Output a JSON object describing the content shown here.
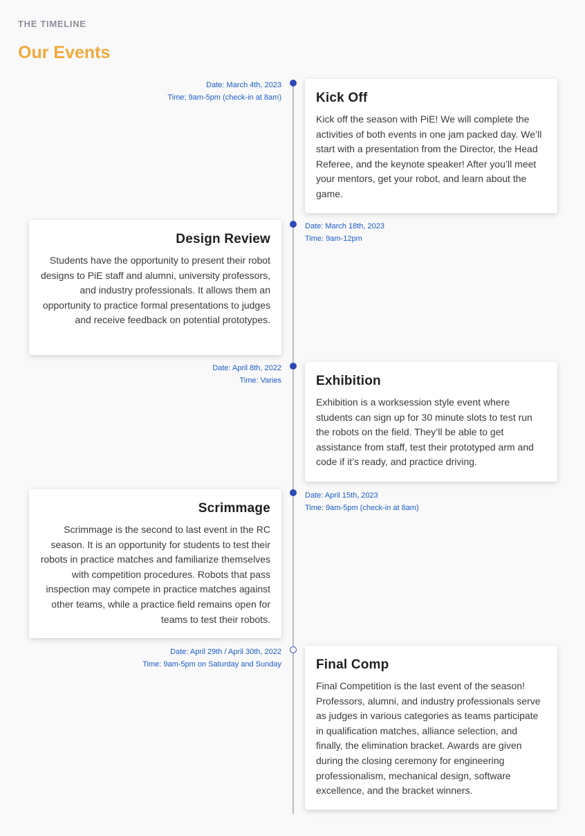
{
  "header": {
    "eyebrow": "THE TIMELINE",
    "title": "Our Events"
  },
  "colors": {
    "accent": "#f2a93b",
    "timeline_dot": "#2f49b8",
    "meta_text": "#1a5cc8",
    "timeline_line": "#b9bcc2"
  },
  "events": [
    {
      "date": "Date: March 4th, 2023",
      "time": "Time: 9am-5pm (check-in at 8am)",
      "title": "Kick Off",
      "description": "Kick off the season with PiE! We will complete the activities of both events in one jam packed day. We’ll start with a presentation from the Director, the Head Referee, and the keynote speaker! After you’ll meet your mentors, get your robot, and learn about the game."
    },
    {
      "date": "Date: March 18th, 2023",
      "time": "Time: 9am-12pm",
      "title": "Design Review",
      "description": "Students have the opportunity to present their robot designs to PiE staff and alumni, university professors, and industry professionals. It allows them an opportunity to practice formal presentations to judges and receive feedback on potential prototypes."
    },
    {
      "date": "Date: April 8th, 2022",
      "time": "Time: Varies",
      "title": "Exhibition",
      "description": "Exhibition is a worksession style event where students can sign up for 30 minute slots to test run the robots on the field. They’ll be able to get assistance from staff, test their prototyped arm and code if it’s ready, and practice driving."
    },
    {
      "date": "Date: April 15th, 2023",
      "time": "Time: 9am-5pm (check-in at 8am)",
      "title": "Scrimmage",
      "description": "Scrimmage is the second to last event in the RC season. It is an opportunity for students to test their robots in practice matches and familiarize themselves with competition procedures. Robots that pass inspection may compete in practice matches against other teams, while a practice field remains open for teams to test their robots."
    },
    {
      "date": "Date: April 29th / April 30th, 2022",
      "time": "Time: 9am-5pm on Saturday and Sunday",
      "title": "Final Comp",
      "description": "Final Competition is the last event of the season! Professors, alumni, and industry professionals serve as judges in various categories as teams participate in qualification matches, alliance selection, and finally, the elimination bracket. Awards are given during the closing ceremony for engineering professionalism, mechanical design, software excellence, and the bracket winners."
    }
  ]
}
